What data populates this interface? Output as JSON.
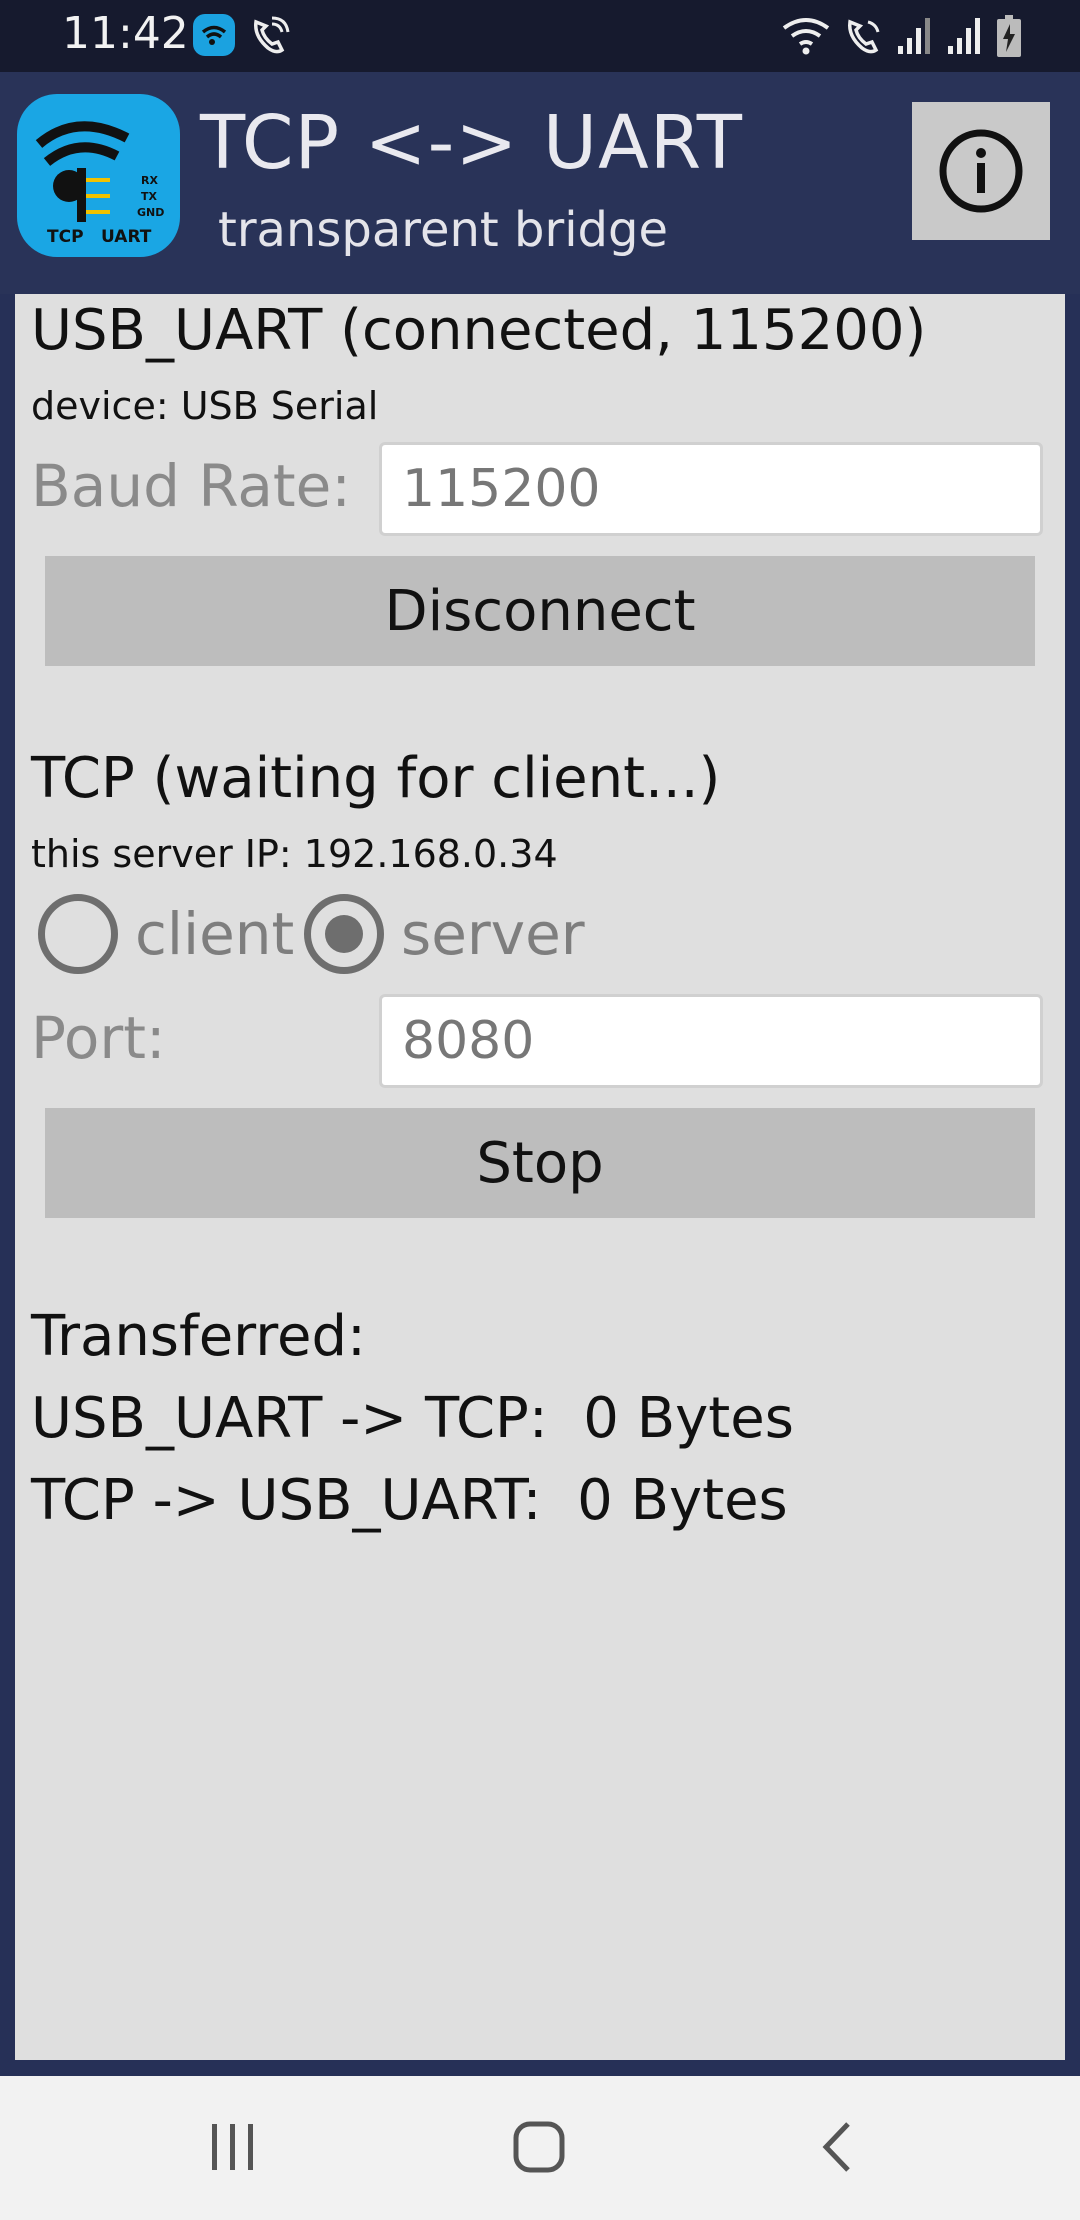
{
  "status_bar": {
    "time": "11:42",
    "icons": [
      "app-notification-icon",
      "wifi-call-icon",
      "wifi-icon",
      "volte-icon",
      "signal-1-icon",
      "signal-2-icon",
      "battery-charging-icon"
    ]
  },
  "header": {
    "title": "TCP <-> UART",
    "subtitle": "transparent bridge",
    "logo_labels": [
      "RX",
      "TX",
      "GND",
      "TCP",
      "UART"
    ],
    "info_icon": "info-icon"
  },
  "usb": {
    "title": "USB_UART (connected, 115200)",
    "device": "device: USB Serial",
    "baud_label": "Baud Rate:",
    "baud_value": "115200",
    "button": "Disconnect"
  },
  "tcp": {
    "title": "TCP (waiting for client...)",
    "server_ip": "this server IP: 192.168.0.34",
    "mode_options": [
      {
        "label": "client",
        "selected": false
      },
      {
        "label": "server",
        "selected": true
      }
    ],
    "port_label": "Port:",
    "port_value": "8080",
    "button": "Stop"
  },
  "transfer": {
    "heading": "Transferred:",
    "uart_to_tcp": "USB_UART -> TCP:  0 Bytes",
    "tcp_to_uart": "TCP -> USB_UART:  0 Bytes"
  },
  "nav": {
    "buttons": [
      "recent-apps-icon",
      "home-icon",
      "back-icon"
    ]
  },
  "colors": {
    "header_bg": "#293358",
    "status_bg": "#161a2e",
    "panel_bg": "#dfdfdf",
    "button_bg": "#bdbdbd",
    "logo_bg": "#1aa6e4"
  }
}
